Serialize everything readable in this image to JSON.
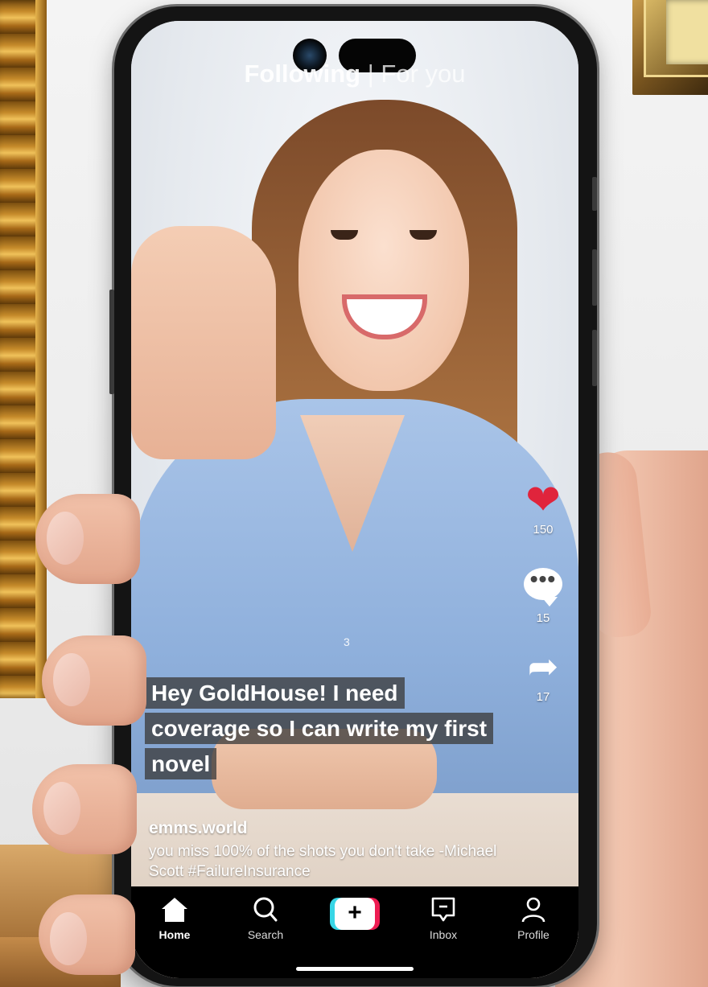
{
  "top_tabs": {
    "following": "Following",
    "separator": "|",
    "for_you": "For you"
  },
  "actions": {
    "like": {
      "icon": "heart-icon",
      "count": "150",
      "color": "#e0243c"
    },
    "comment": {
      "icon": "comment-bubble-icon",
      "count": "15"
    },
    "share": {
      "icon": "share-arrow-icon",
      "count": "17"
    }
  },
  "overlay_number": "3",
  "caption": {
    "line1": "Hey GoldHouse! I need",
    "line2": "coverage so I can write my first",
    "line3": "novel"
  },
  "post": {
    "author": "emms.world",
    "description": "you miss 100% of the shots you don't take -Michael Scott #FailureInsurance"
  },
  "nav": {
    "home": "Home",
    "search": "Search",
    "create": "+",
    "inbox": "Inbox",
    "profile": "Profile"
  },
  "colors": {
    "accent_cyan": "#37d6e6",
    "accent_red": "#ee1d52",
    "nav_bg": "#000000"
  }
}
